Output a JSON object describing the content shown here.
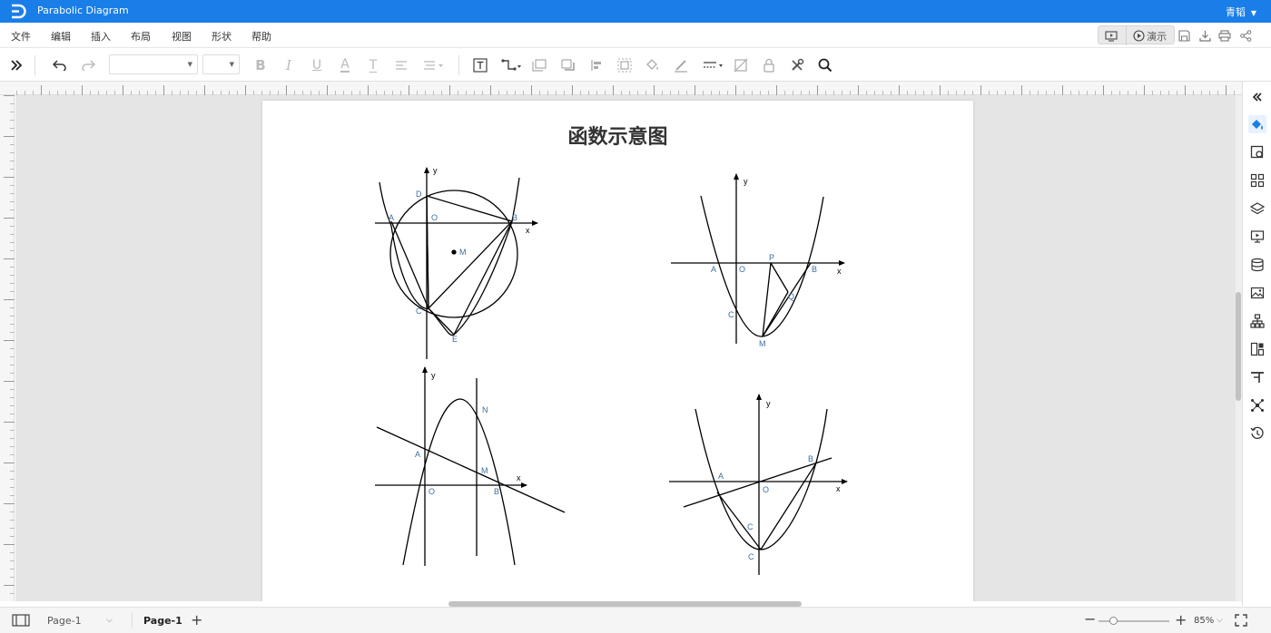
{
  "app": {
    "title": "Parabolic Diagram",
    "user": "青韬",
    "accent_color": "#1a7ee8"
  },
  "menu": {
    "items": [
      "文件",
      "编辑",
      "插入",
      "布局",
      "视图",
      "形状",
      "帮助"
    ],
    "present_label": "演示"
  },
  "page": {
    "title": "函数示意图"
  },
  "diagram": {
    "label_color": "#3b6fa0",
    "fig1": {
      "x": "x",
      "y": "y",
      "A": "A",
      "O": "O",
      "B": "B",
      "D": "D",
      "M": "M",
      "C": "C",
      "E": "E"
    },
    "fig2": {
      "x": "x",
      "y": "y",
      "A": "A",
      "O": "O",
      "P": "P",
      "B": "B",
      "Q": "Q",
      "C": "C",
      "M": "M"
    },
    "fig3": {
      "x": "x",
      "y": "y",
      "N": "N",
      "A": "A",
      "M": "M",
      "O": "O",
      "B": "B"
    },
    "fig4": {
      "x": "x",
      "y": "y",
      "A": "A",
      "O": "O",
      "B": "B",
      "C1": "C",
      "C2": "C"
    }
  },
  "statusbar": {
    "page_selector": "Page-1",
    "active_tab": "Page-1",
    "zoom": "85%"
  },
  "icons": {
    "toolbar": [
      "expand-icon",
      "undo-icon",
      "redo-icon",
      "bold-icon",
      "italic-icon",
      "underline-icon",
      "font-color-icon",
      "text-style-icon",
      "align-icon",
      "line-spacing-icon",
      "text-box-icon",
      "connector-icon",
      "container-icon",
      "shadow-icon",
      "align-objects-icon",
      "group-icon",
      "fill-icon",
      "line-color-icon",
      "line-style-icon",
      "clear-style-icon",
      "lock-icon",
      "tools-icon",
      "search-icon"
    ],
    "sidebar": [
      "collapse-icon",
      "paint-icon",
      "style-icon",
      "apps-icon",
      "layers-icon",
      "present-icon",
      "data-icon",
      "image-icon",
      "hierarchy-icon",
      "layout-icon",
      "note-icon",
      "network-icon",
      "history-icon"
    ]
  }
}
